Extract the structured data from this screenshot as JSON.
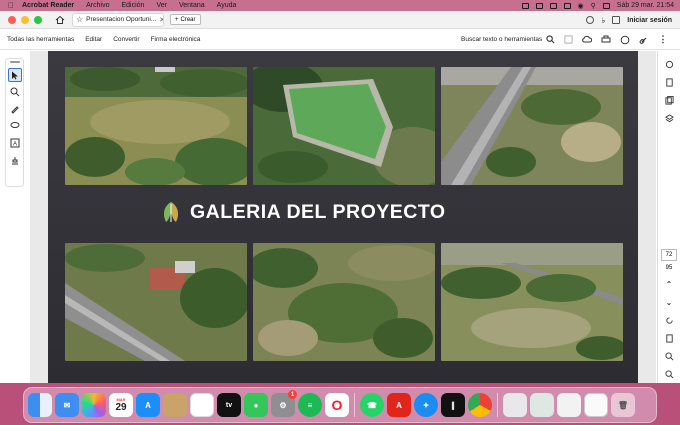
{
  "menubar": {
    "app_name": "Acrobat Reader",
    "items": [
      "Archivo",
      "Edición",
      "Ver",
      "Ventana",
      "Ayuda"
    ],
    "datetime": "Sáb 29 mar.  21:54"
  },
  "tabs": {
    "doc_tab_label": "Presentacion Oportuni...",
    "create_label": "Crear",
    "sign_in_label": "Iniciar sesión"
  },
  "toolbar": {
    "all_tools": "Todas las herramientas",
    "edit": "Editar",
    "convert": "Convertir",
    "esign": "Firma electrónica",
    "search_label": "Buscar texto o herramientas"
  },
  "page": {
    "title": "GALERIA DEL PROYECTO"
  },
  "rightrail": {
    "page_number": "72",
    "page_total": "95"
  },
  "dock": {
    "calendar_day": "29",
    "calendar_month": "MAR",
    "tv_label": "tv",
    "settings_badge": "1"
  },
  "colors": {
    "menubar": "#c76f8e",
    "page_bg": "#34343a",
    "accent": "#3b73d9"
  }
}
